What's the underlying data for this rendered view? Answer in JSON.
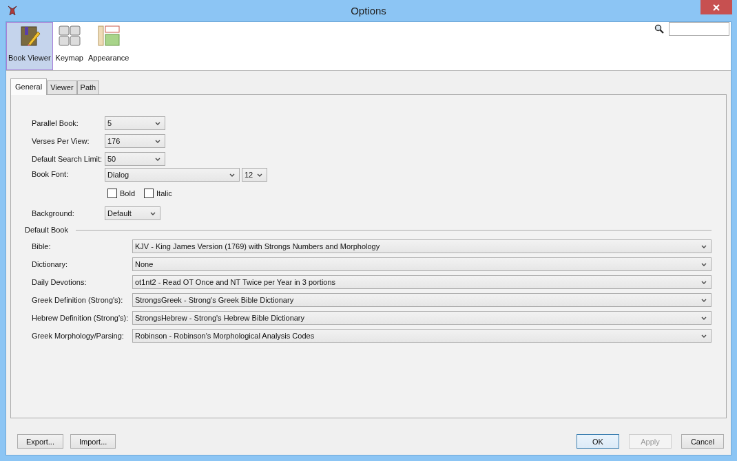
{
  "window": {
    "title": "Options"
  },
  "categories": [
    {
      "label": "Book Viewer",
      "kind": "book",
      "selected": true
    },
    {
      "label": "Keymap",
      "kind": "keys",
      "selected": false
    },
    {
      "label": "Appearance",
      "kind": "appearance",
      "selected": false
    }
  ],
  "tabs": [
    {
      "label": "General",
      "selected": true
    },
    {
      "label": "Viewer",
      "selected": false
    },
    {
      "label": "Path",
      "selected": false
    }
  ],
  "settings": [
    {
      "label": "Parallel Book:",
      "value": "5"
    },
    {
      "label": "Verses Per View:",
      "value": "176"
    },
    {
      "label": "Default Search Limit:",
      "value": "50"
    }
  ],
  "book_font": {
    "label": "Book Font:",
    "font": "Dialog",
    "size": "12"
  },
  "checkboxes": [
    {
      "label": "Bold",
      "checked": false
    },
    {
      "label": "Italic",
      "checked": false
    }
  ],
  "background": {
    "label": "Background:",
    "value": "Default"
  },
  "default_book": {
    "title": "Default Book",
    "rows": [
      {
        "label": "Bible:",
        "value": "KJV - King James Version (1769) with Strongs Numbers and Morphology"
      },
      {
        "label": "Dictionary:",
        "value": "None"
      },
      {
        "label": "Daily Devotions:",
        "value": "ot1nt2 - Read OT Once and NT Twice per Year in 3 portions"
      },
      {
        "label": "Greek Definition (Strong's):",
        "value": "StrongsGreek - Strong's Greek Bible Dictionary"
      },
      {
        "label": "Hebrew Definition (Strong's):",
        "value": "StrongsHebrew - Strong's Hebrew Bible Dictionary"
      },
      {
        "label": "Greek Morphology/Parsing:",
        "value": "Robinson - Robinson's Morphological Analysis Codes"
      }
    ]
  },
  "left_buttons": [
    {
      "label": "Export...",
      "disabled": false,
      "focused": false
    },
    {
      "label": "Import...",
      "disabled": false,
      "focused": false
    }
  ],
  "right_buttons": [
    {
      "label": "OK",
      "disabled": false,
      "focused": true
    },
    {
      "label": "Apply",
      "disabled": true,
      "focused": false
    },
    {
      "label": "Cancel",
      "disabled": false,
      "focused": false
    }
  ]
}
